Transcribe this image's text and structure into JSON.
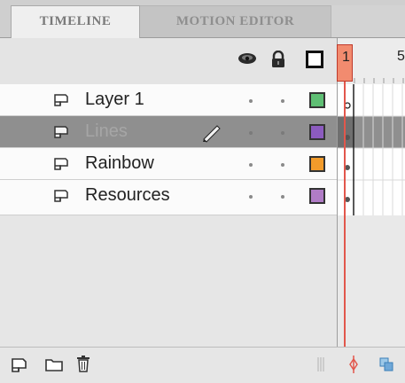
{
  "tabs": [
    {
      "label": "TIMELINE",
      "active": true
    },
    {
      "label": "MOTION EDITOR",
      "active": false
    }
  ],
  "header": {
    "show_hide_icon": "eye-icon",
    "lock_icon": "lock-icon",
    "outline_icon": "outline-square-icon"
  },
  "layers": [
    {
      "name": "Layer 1",
      "color": "#5fbf74",
      "selected": false
    },
    {
      "name": "Lines",
      "color": "#8c5bbf",
      "selected": true
    },
    {
      "name": "Rainbow",
      "color": "#f29b2b",
      "selected": false
    },
    {
      "name": "Resources",
      "color": "#b07cc6",
      "selected": false
    }
  ],
  "frames": {
    "current_frame": "1",
    "ruler_label": "5"
  },
  "bottom": {
    "new_layer_icon": "new-layer-icon",
    "new_folder_icon": "folder-icon",
    "delete_icon": "trash-icon"
  }
}
